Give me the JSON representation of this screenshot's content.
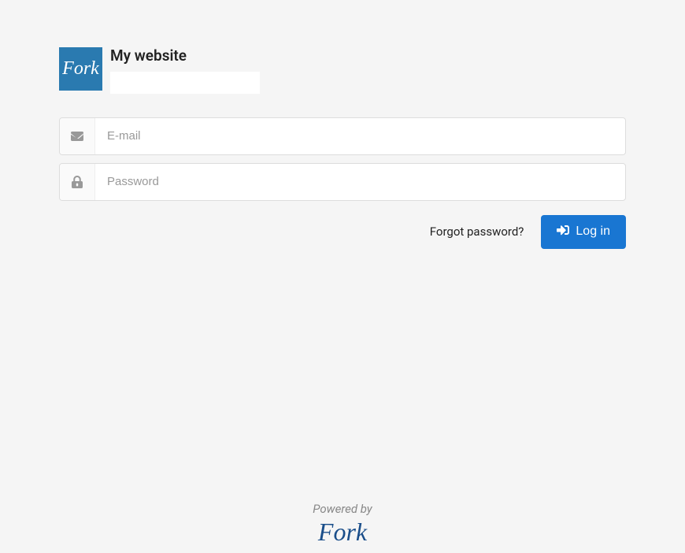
{
  "header": {
    "logo_text": "Fork",
    "site_title": "My website"
  },
  "form": {
    "email": {
      "placeholder": "E-mail",
      "value": ""
    },
    "password": {
      "placeholder": "Password",
      "value": ""
    }
  },
  "actions": {
    "forgot_label": "Forgot password?",
    "login_label": "Log in"
  },
  "footer": {
    "powered_by": "Powered by",
    "brand": "Fork"
  }
}
